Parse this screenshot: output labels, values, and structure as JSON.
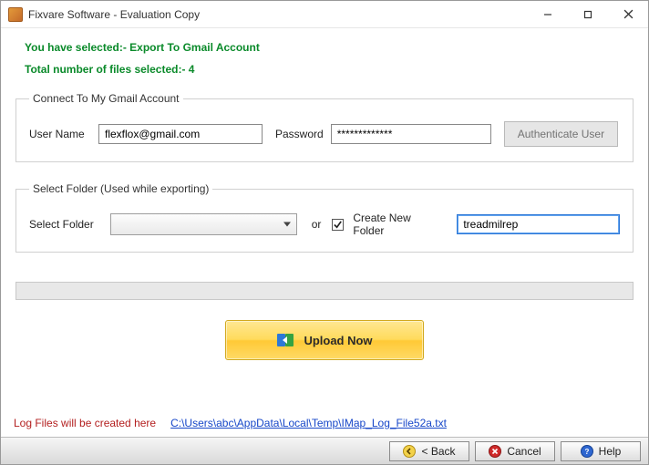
{
  "window": {
    "title": "Fixvare Software - Evaluation Copy"
  },
  "header": {
    "selected_line": "You have selected:- Export To Gmail Account",
    "total_files_line": "Total number of files selected:- 4"
  },
  "group_connect": {
    "legend": "Connect To My Gmail Account",
    "username_label": "User Name",
    "username_value": "flexflox@gmail.com",
    "password_label": "Password",
    "password_value": "*************",
    "auth_button": "Authenticate User"
  },
  "group_folder": {
    "legend": "Select Folder (Used while exporting)",
    "select_label": "Select Folder",
    "or_label": "or",
    "create_label": "Create New Folder",
    "create_checked": true,
    "new_folder_value": "treadmilrep"
  },
  "upload": {
    "label": "Upload Now"
  },
  "log": {
    "label": "Log Files will be created here",
    "path": "C:\\Users\\abc\\AppData\\Local\\Temp\\IMap_Log_File52a.txt"
  },
  "buttons": {
    "back": "< Back",
    "cancel": "Cancel",
    "help": "Help"
  }
}
